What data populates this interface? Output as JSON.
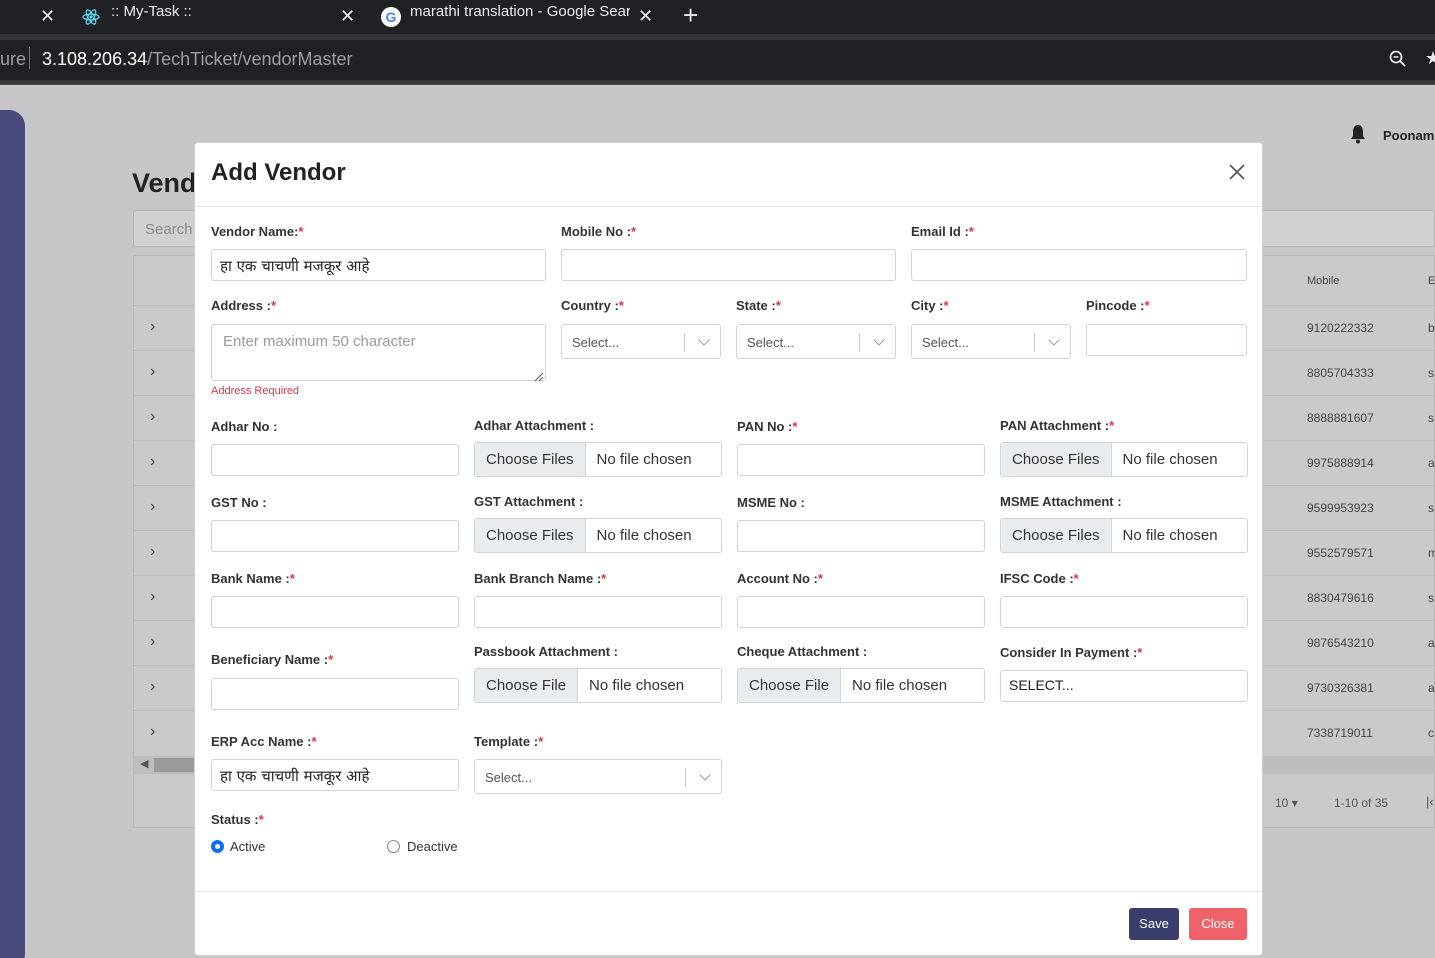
{
  "browser": {
    "tabs": [
      {
        "title": ":: My-Task ::"
      },
      {
        "title": "marathi translation - Google Sear"
      }
    ],
    "url_prefix": "ure",
    "url_host": "3.108.206.34",
    "url_path": "/TechTicket/vendorMaster"
  },
  "background": {
    "page_title": "Vend",
    "search_placeholder": "Search...",
    "user_name": "Poonam",
    "mobile_header": "Mobile",
    "email_header": "E",
    "rows": [
      {
        "mobile": "9120222332",
        "email": "b"
      },
      {
        "mobile": "8805704333",
        "email": "s"
      },
      {
        "mobile": "8888881607",
        "email": "s"
      },
      {
        "mobile": "9975888914",
        "email": "a"
      },
      {
        "mobile": "9599953923",
        "email": "s"
      },
      {
        "mobile": "9552579571",
        "email": "m"
      },
      {
        "mobile": "8830479616",
        "email": "s"
      },
      {
        "mobile": "9876543210",
        "email": "a"
      },
      {
        "mobile": "9730326381",
        "email": "a"
      },
      {
        "mobile": "7338719011",
        "email": "c"
      }
    ],
    "page_size": "10",
    "pagination": "1-10 of 35"
  },
  "modal": {
    "title": "Add Vendor",
    "labels": {
      "vendor_name": "Vendor Name:",
      "mobile_no": "Mobile No :",
      "email_id": "Email Id :",
      "address": "Address :",
      "country": "Country :",
      "state": "State :",
      "city": "City :",
      "pincode": "Pincode :",
      "adhar_no": "Adhar No :",
      "adhar_attachment": "Adhar Attachment :",
      "pan_no": "PAN No :",
      "pan_attachment": "PAN Attachment :",
      "gst_no": "GST No :",
      "gst_attachment": "GST Attachment :",
      "msme_no": "MSME No :",
      "msme_attachment": "MSME Attachment :",
      "bank_name": "Bank Name :",
      "bank_branch_name": "Bank Branch Name :",
      "account_no": "Account No :",
      "ifsc_code": "IFSC Code :",
      "beneficiary_name": "Beneficiary Name :",
      "passbook_attachment": "Passbook Attachment :",
      "cheque_attachment": "Cheque Attachment :",
      "consider_in_payment": "Consider In Payment :",
      "erp_acc_name": "ERP Acc Name :",
      "template": "Template :",
      "status": "Status :"
    },
    "required_mark": "*",
    "values": {
      "vendor_name": "हा एक चाचणी मजकूर आहे",
      "erp_acc_name": "हा एक चाचणी मजकूर आहे",
      "consider_in_payment": "SELECT..."
    },
    "address_placeholder": "Enter maximum 50 character",
    "address_error": "Address Required",
    "select_placeholder": "Select...",
    "choose_files": "Choose Files",
    "choose_file": "Choose File",
    "no_file": "No file chosen",
    "status_options": [
      "Active",
      "Deactive"
    ],
    "status_selected": "Active",
    "save_label": "Save",
    "close_label": "Close"
  },
  "colors": {
    "save": "#3a3e6c",
    "close": "#f0626a",
    "required": "#dc3545",
    "radio_active": "#0d6efd"
  }
}
